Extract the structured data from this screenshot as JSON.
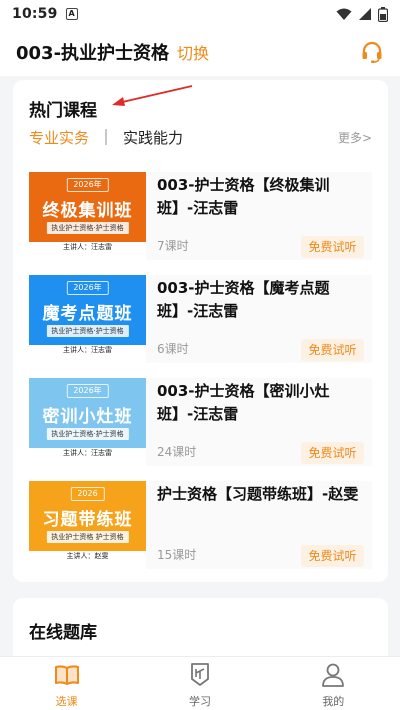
{
  "status_bar": {
    "time": "10:59",
    "notification_icon": "a-notification-icon",
    "wifi_icon": "wifi-icon",
    "signal_icon": "signal-icon",
    "battery_icon": "battery-icon"
  },
  "header": {
    "title": "003-执业护士资格",
    "switch_label": "切换",
    "service_icon": "headset-icon",
    "accent_color": "#f08a1c"
  },
  "hot_courses": {
    "title": "热门课程",
    "tabs": [
      {
        "label": "专业实务",
        "active": true
      },
      {
        "label": "实践能力",
        "active": false
      }
    ],
    "more_label": "更多>",
    "courses": [
      {
        "name": "003-护士资格【终极集训班】-汪志雷",
        "lessons": "7课时",
        "trial_label": "免费试听",
        "thumb": {
          "year": "2026年",
          "title": "终极集训班",
          "subtitle": "执业护士资格·护士资格",
          "lecturer": "主讲人：汪志雷",
          "color": "#ea6a12"
        }
      },
      {
        "name": "003-护士资格【魔考点题班】-汪志雷",
        "lessons": "6课时",
        "trial_label": "免费试听",
        "thumb": {
          "year": "2026年",
          "title": "魔考点题班",
          "subtitle": "执业护士资格·护士资格",
          "lecturer": "主讲人：汪志雷",
          "color": "#1f8ff0"
        }
      },
      {
        "name": "003-护士资格【密训小灶班】-汪志雷",
        "lessons": "24课时",
        "trial_label": "免费试听",
        "thumb": {
          "year": "2026年",
          "title": "密训小灶班",
          "subtitle": "执业护士资格·护士资格",
          "lecturer": "主讲人：汪志雷",
          "color": "#7ec6f0"
        }
      },
      {
        "name": "护士资格【习题带练班】-赵雯",
        "lessons": "15课时",
        "trial_label": "免费试听",
        "thumb": {
          "year": "2026",
          "title": "习题带练班",
          "subtitle": "执业护士资格 护士资格",
          "lecturer": "主讲人：赵雯",
          "color": "#f7a21b"
        }
      }
    ]
  },
  "online_bank": {
    "title": "在线题库"
  },
  "bottom_nav": [
    {
      "label": "选课",
      "icon": "book-open-icon",
      "active": true
    },
    {
      "label": "学习",
      "icon": "study-badge-icon",
      "active": false
    },
    {
      "label": "我的",
      "icon": "user-icon",
      "active": false
    }
  ],
  "annotation": {
    "arrow_color": "#e02a2a",
    "arrow_icon": "red-arrow-icon"
  }
}
